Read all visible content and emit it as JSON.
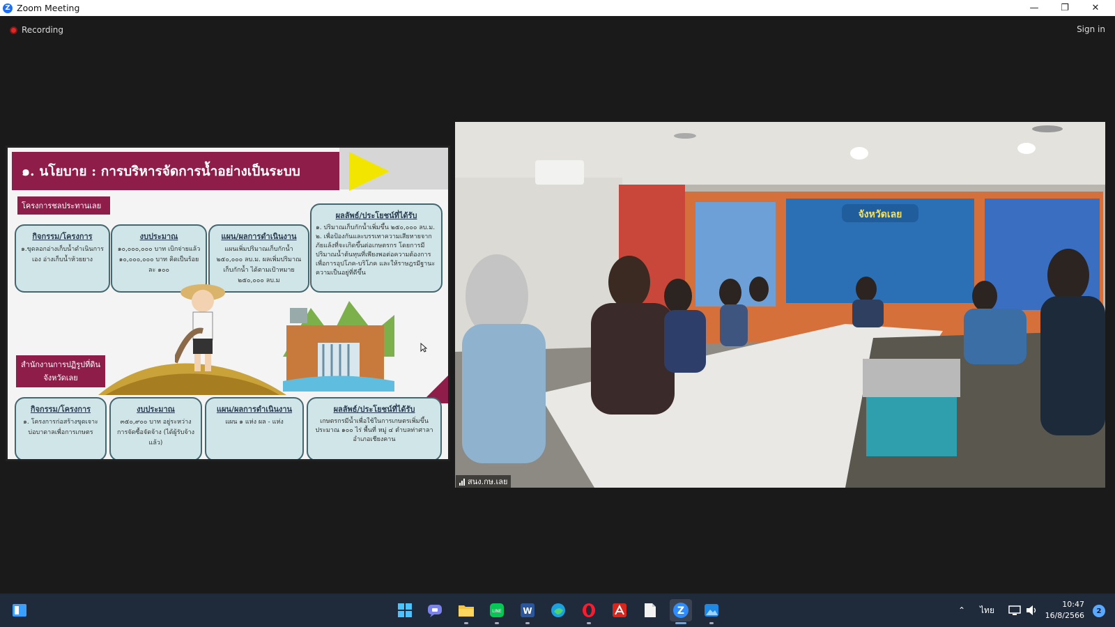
{
  "window": {
    "app_icon": "zoom-icon",
    "title": "Zoom Meeting",
    "controls": [
      "minimize-icon",
      "restore-icon",
      "close-icon"
    ]
  },
  "meeting": {
    "recording_label": "Recording",
    "sign_in_label": "Sign in"
  },
  "slide": {
    "header": "๑. นโยบาย : การบริหารจัดการน้ำอย่างเป็นระบบ",
    "section1_tag": "โครงการชลประทานเลย",
    "section1": {
      "activity": {
        "heading": "กิจกรรม/โครงการ",
        "text": "๑.ขุดลอกอ่างเก็บน้ำดำเนินการเอง อ่างเก็บน้ำห้วยยาง"
      },
      "budget": {
        "heading": "งบประมาณ",
        "text": "๑๐,๐๐๐,๐๐๐ บาท เบิกจ่ายแล้ว ๑๐,๐๐๐,๐๐๐ บาท คิดเป็นร้อยละ ๑๐๐"
      },
      "plan": {
        "heading": "แผน/ผลการดำเนินงาน",
        "text": "แผนเพิ่มปริมาณเก็บกักน้ำ ๒๕๐,๐๐๐ ลบ.ม. ผลเพิ่มปริมาณเก็บกักน้ำ ได้ตามเป้าหมาย ๒๕๐,๐๐๐ ลบ.ม"
      },
      "result": {
        "heading": "ผลลัพธ์/ประโยชน์ที่ได้รับ",
        "text": "๑. ปริมาณเก็บกักน้ำเพิ่มขึ้น ๒๕๐,๐๐๐ ลบ.ม. ๒. เพื่อป้องกันและบรรเทาความเสียหายจากภัยแล้งที่จะเกิดขึ้นต่อเกษตรกร โดยการมีปริมาณน้ำต้นทุนที่เพียงพอต่อความต้องการเพื่อการอุปโภค-บริโภค และให้ราษฎรมีฐานะความเป็นอยู่ที่ดีขึ้น"
      }
    },
    "section2_tag": "สำนักงานการปฏิรูปที่ดินจังหวัดเลย",
    "section2": {
      "activity": {
        "heading": "กิจกรรม/โครงการ",
        "text": "๑. โครงการก่อสร้างขุดเจาะบ่อบาดาลเพื่อการเกษตร"
      },
      "budget": {
        "heading": "งบประมาณ",
        "text": "๓๕๐,๙๐๐ บาท อยู่ระหว่างการจัดซื้อจัดจ้าง (ได้ผู้รับจ้างแล้ว)"
      },
      "plan": {
        "heading": "แผน/ผลการดำเนินงาน",
        "text": "แผน ๑ แห่ง ผล - แห่ง"
      },
      "result": {
        "heading": "ผลลัพธ์/ประโยชน์ที่ได้รับ",
        "text": "เกษตรกรมีน้ำเพื่อใช้ในการเกษตรเพิ่มขึ้น ประมาณ ๑๐๐ ไร่ พื้นที่ หมู่ ๔ ตำบลท่าศาลา อำเภอเชียงคาน"
      }
    }
  },
  "video": {
    "participant_name": "สนง.กษ.เลย",
    "banner_center": "จังหวัดเลย"
  },
  "taskbar": {
    "apps": [
      "windows-start-icon",
      "teams-chat-icon",
      "file-explorer-icon",
      "line-icon",
      "word-icon",
      "edge-icon",
      "opera-icon",
      "acrobat-icon",
      "notepad-icon",
      "zoom-icon",
      "photos-icon"
    ],
    "language": "ไทย",
    "time": "10:47",
    "date": "16/8/2566",
    "notifications": "2"
  },
  "colors": {
    "slide_accent": "#8e1d4a",
    "box_fill": "#cfe5e8",
    "taskbar": "#1f2a3a",
    "zoom_blue": "#1d6ef5"
  }
}
